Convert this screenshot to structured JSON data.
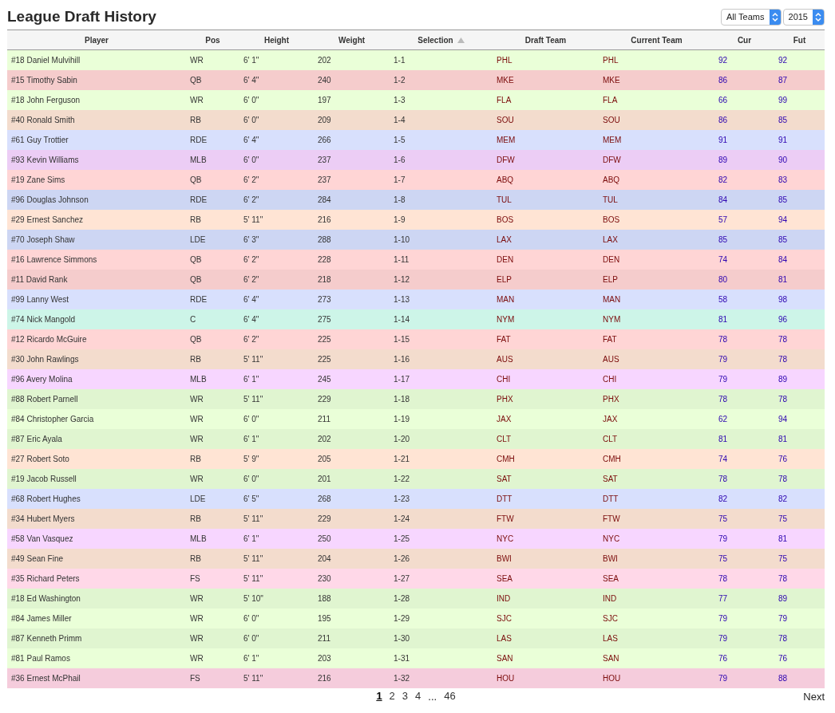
{
  "title": "League Draft History",
  "filters": [
    {
      "value": "All Teams"
    },
    {
      "value": "2015"
    }
  ],
  "table": {
    "columns": [
      {
        "label": "Player",
        "sorted": false
      },
      {
        "label": "Pos",
        "sorted": false
      },
      {
        "label": "Height",
        "sorted": false
      },
      {
        "label": "Weight",
        "sorted": false
      },
      {
        "label": "Selection",
        "sorted": true
      },
      {
        "label": "Draft Team",
        "sorted": false
      },
      {
        "label": "Current Team",
        "sorted": false
      },
      {
        "label": "Cur",
        "sorted": false
      },
      {
        "label": "Fut",
        "sorted": false
      }
    ],
    "rows": [
      {
        "player": "#18 Daniel Mulvihill",
        "pos": "WR",
        "height": "6' 1\"",
        "weight": "202",
        "selection": "1-1",
        "draft_team": "PHL",
        "current_team": "PHL",
        "cur": "92",
        "fut": "92",
        "color": "#eaffd8"
      },
      {
        "player": "#15 Timothy Sabin",
        "pos": "QB",
        "height": "6' 4\"",
        "weight": "240",
        "selection": "1-2",
        "draft_team": "MKE",
        "current_team": "MKE",
        "cur": "86",
        "fut": "87",
        "color": "#f5cccc"
      },
      {
        "player": "#18 John Ferguson",
        "pos": "WR",
        "height": "6' 0\"",
        "weight": "197",
        "selection": "1-3",
        "draft_team": "FLA",
        "current_team": "FLA",
        "cur": "66",
        "fut": "99",
        "color": "#eaffd8"
      },
      {
        "player": "#40 Ronald Smith",
        "pos": "RB",
        "height": "6' 0\"",
        "weight": "209",
        "selection": "1-4",
        "draft_team": "SOU",
        "current_team": "SOU",
        "cur": "86",
        "fut": "85",
        "color": "#f3dccd"
      },
      {
        "player": "#61 Guy Trottier",
        "pos": "RDE",
        "height": "6' 4\"",
        "weight": "266",
        "selection": "1-5",
        "draft_team": "MEM",
        "current_team": "MEM",
        "cur": "91",
        "fut": "91",
        "color": "#d8e0fd"
      },
      {
        "player": "#93 Kevin Williams",
        "pos": "MLB",
        "height": "6' 0\"",
        "weight": "237",
        "selection": "1-6",
        "draft_team": "DFW",
        "current_team": "DFW",
        "cur": "89",
        "fut": "90",
        "color": "#eccdf5"
      },
      {
        "player": "#19 Zane Sims",
        "pos": "QB",
        "height": "6' 2\"",
        "weight": "237",
        "selection": "1-7",
        "draft_team": "ABQ",
        "current_team": "ABQ",
        "cur": "82",
        "fut": "83",
        "color": "#ffd5d5"
      },
      {
        "player": "#96 Douglas Johnson",
        "pos": "RDE",
        "height": "6' 2\"",
        "weight": "284",
        "selection": "1-8",
        "draft_team": "TUL",
        "current_team": "TUL",
        "cur": "84",
        "fut": "85",
        "color": "#cdd6f3"
      },
      {
        "player": "#29 Ernest Sanchez",
        "pos": "RB",
        "height": "5' 11\"",
        "weight": "216",
        "selection": "1-9",
        "draft_team": "BOS",
        "current_team": "BOS",
        "cur": "57",
        "fut": "94",
        "color": "#ffe4d4"
      },
      {
        "player": "#70 Joseph Shaw",
        "pos": "LDE",
        "height": "6' 3\"",
        "weight": "288",
        "selection": "1-10",
        "draft_team": "LAX",
        "current_team": "LAX",
        "cur": "85",
        "fut": "85",
        "color": "#cdd6f3"
      },
      {
        "player": "#16 Lawrence Simmons",
        "pos": "QB",
        "height": "6' 2\"",
        "weight": "228",
        "selection": "1-11",
        "draft_team": "DEN",
        "current_team": "DEN",
        "cur": "74",
        "fut": "84",
        "color": "#ffd5d5"
      },
      {
        "player": "#11 David Rank",
        "pos": "QB",
        "height": "6' 2\"",
        "weight": "218",
        "selection": "1-12",
        "draft_team": "ELP",
        "current_team": "ELP",
        "cur": "80",
        "fut": "81",
        "color": "#f5cccc"
      },
      {
        "player": "#99 Lanny West",
        "pos": "RDE",
        "height": "6' 4\"",
        "weight": "273",
        "selection": "1-13",
        "draft_team": "MAN",
        "current_team": "MAN",
        "cur": "58",
        "fut": "98",
        "color": "#d8e0fd"
      },
      {
        "player": "#74 Nick Mangold",
        "pos": "C",
        "height": "6' 4\"",
        "weight": "275",
        "selection": "1-14",
        "draft_team": "NYM",
        "current_team": "NYM",
        "cur": "81",
        "fut": "96",
        "color": "#cdf5e8"
      },
      {
        "player": "#12 Ricardo McGuire",
        "pos": "QB",
        "height": "6' 2\"",
        "weight": "225",
        "selection": "1-15",
        "draft_team": "FAT",
        "current_team": "FAT",
        "cur": "78",
        "fut": "78",
        "color": "#ffd5d5"
      },
      {
        "player": "#30 John Rawlings",
        "pos": "RB",
        "height": "5' 11\"",
        "weight": "225",
        "selection": "1-16",
        "draft_team": "AUS",
        "current_team": "AUS",
        "cur": "79",
        "fut": "78",
        "color": "#f3dccd"
      },
      {
        "player": "#96 Avery Molina",
        "pos": "MLB",
        "height": "6' 1\"",
        "weight": "245",
        "selection": "1-17",
        "draft_team": "CHI",
        "current_team": "CHI",
        "cur": "79",
        "fut": "89",
        "color": "#f7d6ff"
      },
      {
        "player": "#88 Robert Parnell",
        "pos": "WR",
        "height": "5' 11\"",
        "weight": "229",
        "selection": "1-18",
        "draft_team": "PHX",
        "current_team": "PHX",
        "cur": "78",
        "fut": "78",
        "color": "#e0f5d0"
      },
      {
        "player": "#84 Christopher Garcia",
        "pos": "WR",
        "height": "6' 0\"",
        "weight": "211",
        "selection": "1-19",
        "draft_team": "JAX",
        "current_team": "JAX",
        "cur": "62",
        "fut": "94",
        "color": "#eaffd8"
      },
      {
        "player": "#87 Eric Ayala",
        "pos": "WR",
        "height": "6' 1\"",
        "weight": "202",
        "selection": "1-20",
        "draft_team": "CLT",
        "current_team": "CLT",
        "cur": "81",
        "fut": "81",
        "color": "#e0f5d0"
      },
      {
        "player": "#27 Robert Soto",
        "pos": "RB",
        "height": "5' 9\"",
        "weight": "205",
        "selection": "1-21",
        "draft_team": "CMH",
        "current_team": "CMH",
        "cur": "74",
        "fut": "76",
        "color": "#ffe4d4"
      },
      {
        "player": "#19 Jacob Russell",
        "pos": "WR",
        "height": "6' 0\"",
        "weight": "201",
        "selection": "1-22",
        "draft_team": "SAT",
        "current_team": "SAT",
        "cur": "78",
        "fut": "78",
        "color": "#e0f5d0"
      },
      {
        "player": "#68 Robert Hughes",
        "pos": "LDE",
        "height": "6' 5\"",
        "weight": "268",
        "selection": "1-23",
        "draft_team": "DTT",
        "current_team": "DTT",
        "cur": "82",
        "fut": "82",
        "color": "#d8e0fd"
      },
      {
        "player": "#34 Hubert Myers",
        "pos": "RB",
        "height": "5' 11\"",
        "weight": "229",
        "selection": "1-24",
        "draft_team": "FTW",
        "current_team": "FTW",
        "cur": "75",
        "fut": "75",
        "color": "#f3dccd"
      },
      {
        "player": "#58 Van Vasquez",
        "pos": "MLB",
        "height": "6' 1\"",
        "weight": "250",
        "selection": "1-25",
        "draft_team": "NYC",
        "current_team": "NYC",
        "cur": "79",
        "fut": "81",
        "color": "#f7d6ff"
      },
      {
        "player": "#49 Sean Fine",
        "pos": "RB",
        "height": "5' 11\"",
        "weight": "204",
        "selection": "1-26",
        "draft_team": "BWI",
        "current_team": "BWI",
        "cur": "75",
        "fut": "75",
        "color": "#f3dccd"
      },
      {
        "player": "#35 Richard Peters",
        "pos": "FS",
        "height": "5' 11\"",
        "weight": "230",
        "selection": "1-27",
        "draft_team": "SEA",
        "current_team": "SEA",
        "cur": "78",
        "fut": "78",
        "color": "#ffd8e8"
      },
      {
        "player": "#18 Ed Washington",
        "pos": "WR",
        "height": "5' 10\"",
        "weight": "188",
        "selection": "1-28",
        "draft_team": "IND",
        "current_team": "IND",
        "cur": "77",
        "fut": "89",
        "color": "#e0f5d0"
      },
      {
        "player": "#84 James Miller",
        "pos": "WR",
        "height": "6' 0\"",
        "weight": "195",
        "selection": "1-29",
        "draft_team": "SJC",
        "current_team": "SJC",
        "cur": "79",
        "fut": "79",
        "color": "#eaffd8"
      },
      {
        "player": "#87 Kenneth Primm",
        "pos": "WR",
        "height": "6' 0\"",
        "weight": "211",
        "selection": "1-30",
        "draft_team": "LAS",
        "current_team": "LAS",
        "cur": "79",
        "fut": "78",
        "color": "#e0f5d0"
      },
      {
        "player": "#81 Paul Ramos",
        "pos": "WR",
        "height": "6' 1\"",
        "weight": "203",
        "selection": "1-31",
        "draft_team": "SAN",
        "current_team": "SAN",
        "cur": "76",
        "fut": "76",
        "color": "#eaffd8"
      },
      {
        "player": "#36 Ernest McPhail",
        "pos": "FS",
        "height": "5' 11\"",
        "weight": "216",
        "selection": "1-32",
        "draft_team": "HOU",
        "current_team": "HOU",
        "cur": "79",
        "fut": "88",
        "color": "#f5ccdc"
      }
    ]
  },
  "pagination": {
    "pages": [
      {
        "label": "1",
        "selected": true
      },
      {
        "label": "2",
        "selected": false
      },
      {
        "label": "3",
        "selected": false
      },
      {
        "label": "4",
        "selected": false
      }
    ],
    "ellipsis": "...",
    "last_page": {
      "label": "46",
      "selected": false
    },
    "next": "Next"
  }
}
